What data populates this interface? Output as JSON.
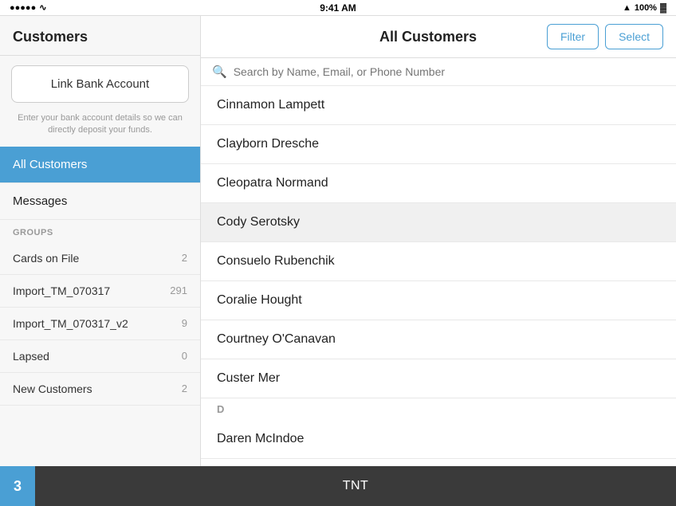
{
  "statusBar": {
    "time": "9:41 AM",
    "signal": "●●●●●",
    "wifi": "wifi",
    "location": "▲",
    "battery": "100%"
  },
  "sidebar": {
    "title": "Customers",
    "linkBankAccount": {
      "label": "Link Bank Account",
      "description": "Enter your bank account details so we can directly deposit your funds."
    },
    "navItems": [
      {
        "label": "All Customers",
        "active": true
      },
      {
        "label": "Messages",
        "active": false
      }
    ],
    "groupsHeader": "GROUPS",
    "groups": [
      {
        "label": "Cards on File",
        "count": "2"
      },
      {
        "label": "Import_TM_070317",
        "count": "291"
      },
      {
        "label": "Import_TM_070317_v2",
        "count": "9"
      },
      {
        "label": "Lapsed",
        "count": "0"
      },
      {
        "label": "New Customers",
        "count": "2"
      }
    ]
  },
  "content": {
    "title": "All Customers",
    "filterLabel": "Filter",
    "selectLabel": "Select",
    "searchPlaceholder": "Search by Name, Email, or Phone Number",
    "customers": [
      {
        "name": "Cinnamon Lampett",
        "selected": false,
        "section": ""
      },
      {
        "name": "Clayborn Dresche",
        "selected": false,
        "section": ""
      },
      {
        "name": "Cleopatra Normand",
        "selected": false,
        "section": ""
      },
      {
        "name": "Cody Serotsky",
        "selected": true,
        "section": ""
      },
      {
        "name": "Consuelo Rubenchik",
        "selected": false,
        "section": ""
      },
      {
        "name": "Coralie Hought",
        "selected": false,
        "section": ""
      },
      {
        "name": "Courtney O'Canavan",
        "selected": false,
        "section": ""
      },
      {
        "name": "Custer Mer",
        "selected": false,
        "section": ""
      }
    ],
    "sectionD": "D",
    "dCustomers": [
      {
        "name": "Daren McIndoe",
        "selected": false
      }
    ]
  },
  "tabBar": {
    "badge": "3",
    "label": "TNT"
  }
}
